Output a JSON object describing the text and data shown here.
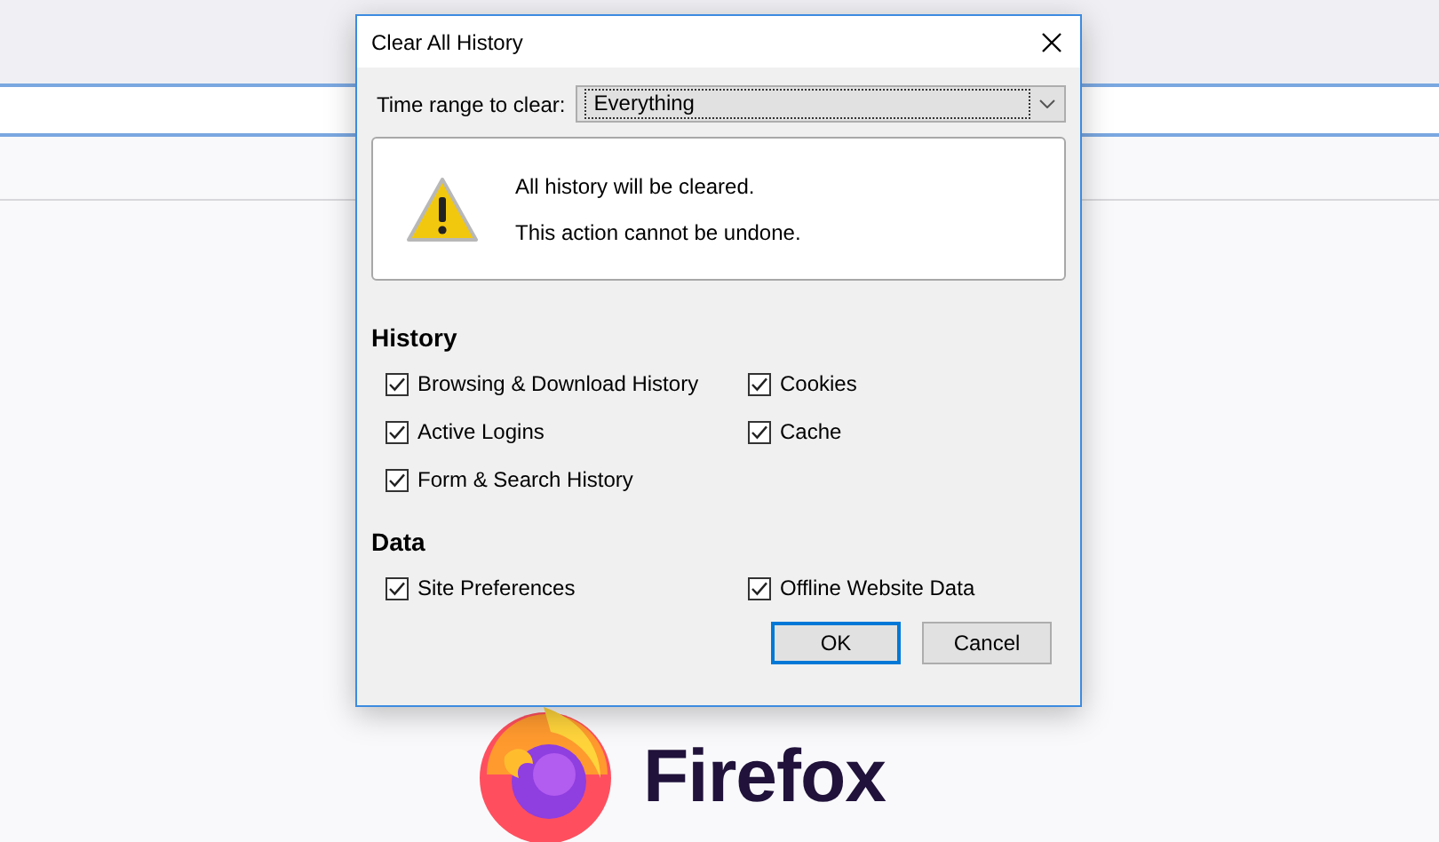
{
  "browser": {
    "logo_text": "Firefox"
  },
  "dialog": {
    "title": "Clear All History",
    "time_range": {
      "label": "Time range to clear:",
      "value": "Everything"
    },
    "warning": {
      "lines": [
        "All history will be cleared.",
        "This action cannot be undone."
      ]
    },
    "sections": [
      {
        "heading": "History",
        "columns": [
          [
            {
              "label": "Browsing & Download History",
              "checked": true
            },
            {
              "label": "Active Logins",
              "checked": true
            },
            {
              "label": "Form & Search History",
              "checked": true
            }
          ],
          [
            {
              "label": "Cookies",
              "checked": true
            },
            {
              "label": "Cache",
              "checked": true
            }
          ]
        ]
      },
      {
        "heading": "Data",
        "columns": [
          [
            {
              "label": "Site Preferences",
              "checked": true
            }
          ],
          [
            {
              "label": "Offline Website Data",
              "checked": true
            }
          ]
        ]
      }
    ],
    "buttons": [
      {
        "label": "OK",
        "default": true
      },
      {
        "label": "Cancel",
        "default": false
      }
    ]
  }
}
